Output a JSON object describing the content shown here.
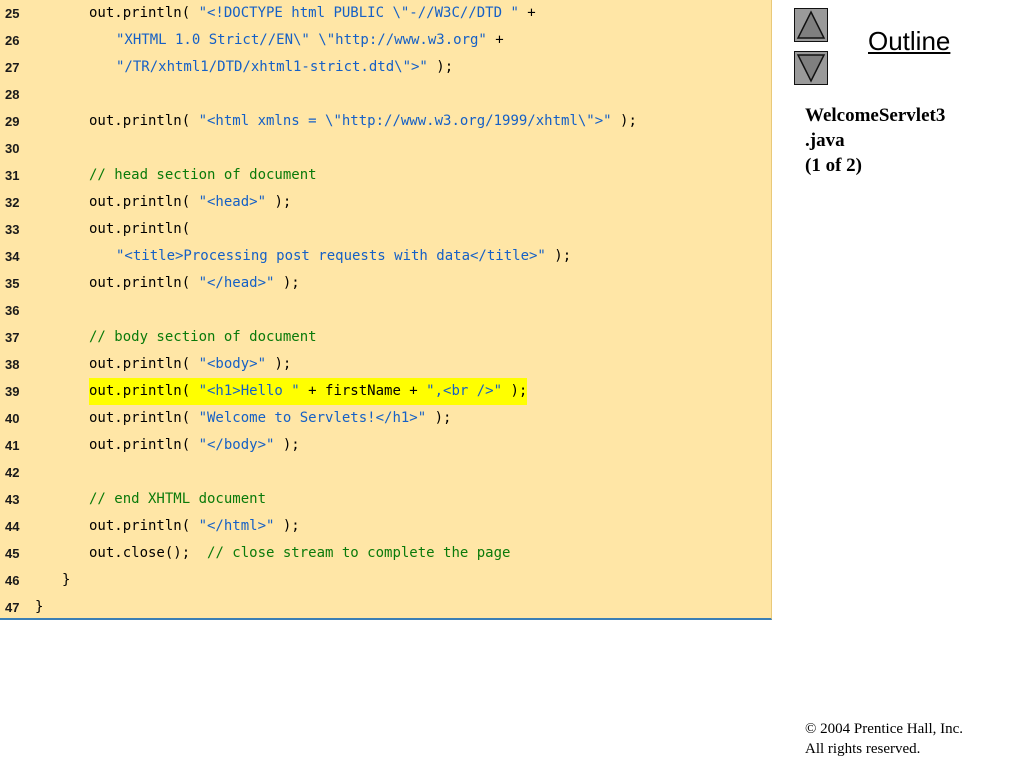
{
  "code": {
    "lines": [
      {
        "n": "25",
        "indent": 2,
        "segs": [
          [
            "p",
            "out.println( "
          ],
          [
            "s",
            "\"<!DOCTYPE html PUBLIC \\\"-//W3C//DTD \""
          ],
          [
            "p",
            " +"
          ]
        ]
      },
      {
        "n": "26",
        "indent": 3,
        "segs": [
          [
            "s",
            "\"XHTML 1.0 Strict//EN\\\" \\\"http://www.w3.org\""
          ],
          [
            "p",
            " +"
          ]
        ]
      },
      {
        "n": "27",
        "indent": 3,
        "segs": [
          [
            "s",
            "\"/TR/xhtml1/DTD/xhtml1-strict.dtd\\\">\""
          ],
          [
            "p",
            " );"
          ]
        ]
      },
      {
        "n": "28",
        "indent": 0,
        "segs": []
      },
      {
        "n": "29",
        "indent": 2,
        "segs": [
          [
            "p",
            "out.println( "
          ],
          [
            "s",
            "\"<html xmlns = \\\"http://www.w3.org/1999/xhtml\\\">\""
          ],
          [
            "p",
            " );"
          ]
        ]
      },
      {
        "n": "30",
        "indent": 0,
        "segs": []
      },
      {
        "n": "31",
        "indent": 2,
        "segs": [
          [
            "c",
            "// head section of document"
          ]
        ]
      },
      {
        "n": "32",
        "indent": 2,
        "segs": [
          [
            "p",
            "out.println( "
          ],
          [
            "s",
            "\"<head>\""
          ],
          [
            "p",
            " );"
          ]
        ]
      },
      {
        "n": "33",
        "indent": 2,
        "segs": [
          [
            "p",
            "out.println("
          ]
        ]
      },
      {
        "n": "34",
        "indent": 3,
        "segs": [
          [
            "s",
            "\"<title>Processing post requests with data</title>\""
          ],
          [
            "p",
            " );"
          ]
        ]
      },
      {
        "n": "35",
        "indent": 2,
        "segs": [
          [
            "p",
            "out.println( "
          ],
          [
            "s",
            "\"</head>\""
          ],
          [
            "p",
            " );"
          ]
        ]
      },
      {
        "n": "36",
        "indent": 0,
        "segs": []
      },
      {
        "n": "37",
        "indent": 2,
        "segs": [
          [
            "c",
            "// body section of document"
          ]
        ]
      },
      {
        "n": "38",
        "indent": 2,
        "segs": [
          [
            "p",
            "out.println( "
          ],
          [
            "s",
            "\"<body>\""
          ],
          [
            "p",
            " );"
          ]
        ]
      },
      {
        "n": "39",
        "indent": 2,
        "hl": true,
        "segs": [
          [
            "p",
            "out.println( "
          ],
          [
            "s",
            "\"<h1>Hello \""
          ],
          [
            "p",
            " + firstName + "
          ],
          [
            "s",
            "\",<br />\""
          ],
          [
            "p",
            " );"
          ]
        ]
      },
      {
        "n": "40",
        "indent": 2,
        "segs": [
          [
            "p",
            "out.println( "
          ],
          [
            "s",
            "\"Welcome to Servlets!</h1>\""
          ],
          [
            "p",
            " );"
          ]
        ]
      },
      {
        "n": "41",
        "indent": 2,
        "segs": [
          [
            "p",
            "out.println( "
          ],
          [
            "s",
            "\"</body>\""
          ],
          [
            "p",
            " );"
          ]
        ]
      },
      {
        "n": "42",
        "indent": 0,
        "segs": []
      },
      {
        "n": "43",
        "indent": 2,
        "segs": [
          [
            "c",
            "// end XHTML document"
          ]
        ]
      },
      {
        "n": "44",
        "indent": 2,
        "segs": [
          [
            "p",
            "out.println( "
          ],
          [
            "s",
            "\"</html>\""
          ],
          [
            "p",
            " );"
          ]
        ]
      },
      {
        "n": "45",
        "indent": 2,
        "segs": [
          [
            "p",
            "out.close();  "
          ],
          [
            "c",
            "// close stream to complete the page"
          ]
        ]
      },
      {
        "n": "46",
        "indent": 1,
        "segs": [
          [
            "p",
            "}"
          ]
        ]
      },
      {
        "n": "47",
        "indent": 0,
        "segs": [
          [
            "p",
            "}"
          ]
        ]
      }
    ]
  },
  "nav": {
    "up_icon": "triangle-up-icon",
    "down_icon": "triangle-down-icon"
  },
  "outline_title": "Outline",
  "file_info": {
    "line1": "WelcomeServlet3",
    "line2": ".java",
    "line3": "(1 of 2)"
  },
  "copyright": {
    "line1": "© 2004 Prentice Hall, Inc.",
    "line2": "All rights reserved."
  },
  "colors": {
    "panel_bg": "#ffe6a6",
    "string": "#1560c6",
    "comment": "#0a7a0a",
    "highlight": "#ffff00",
    "panel_border": "#3b7fb5"
  }
}
